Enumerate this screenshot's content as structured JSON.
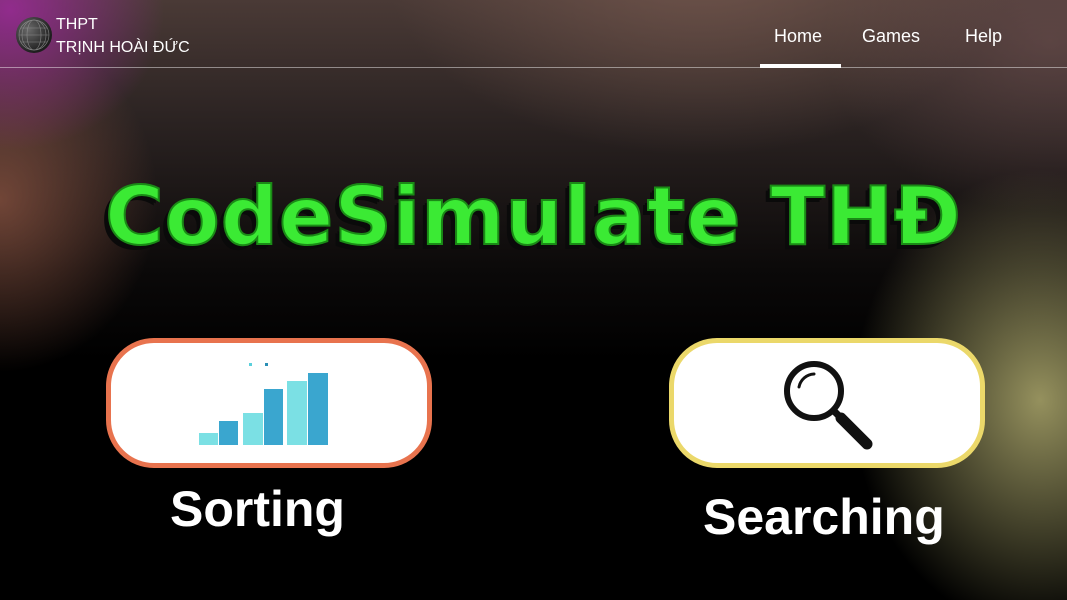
{
  "header": {
    "school_line1": "THPT",
    "school_line2": "TRỊNH HOÀI ĐỨC",
    "nav": [
      {
        "label": "Home",
        "active": true
      },
      {
        "label": "Games",
        "active": false
      },
      {
        "label": "Help",
        "active": false
      }
    ]
  },
  "hero": {
    "title": "CodeSimulate THĐ",
    "title_color": "#3bea34"
  },
  "cards": [
    {
      "label": "Sorting",
      "icon": "bar-chart-icon",
      "border_color": "#e8734e"
    },
    {
      "label": "Searching",
      "icon": "magnifier-icon",
      "border_color": "#ebd86a"
    }
  ]
}
